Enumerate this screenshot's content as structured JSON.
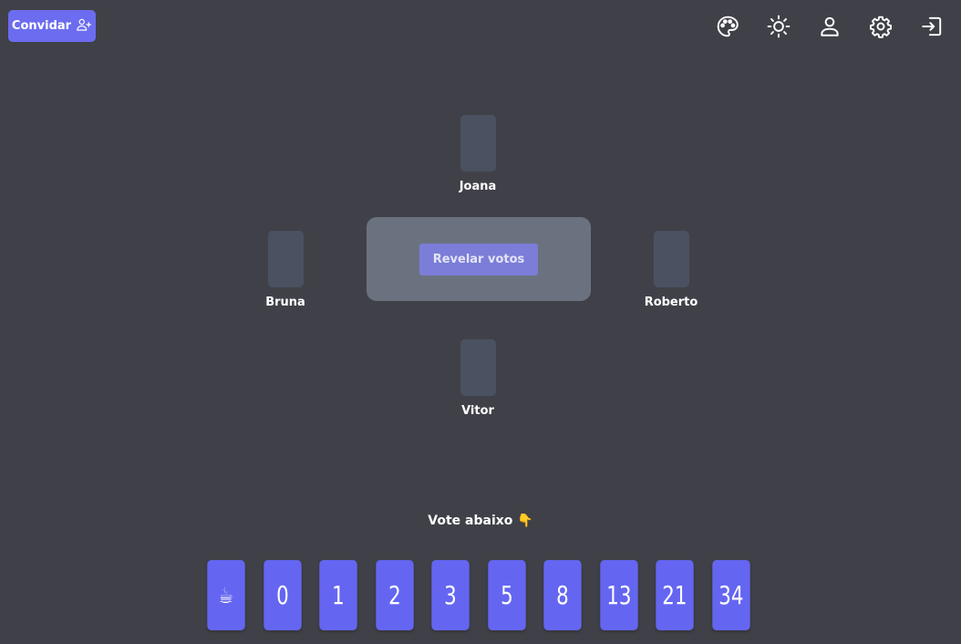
{
  "header": {
    "invite_label": "Convidar",
    "icons": [
      "palette-icon",
      "sun-icon",
      "user-icon",
      "gear-icon",
      "logout-icon"
    ]
  },
  "players": [
    {
      "name": "Joana",
      "position": "top"
    },
    {
      "name": "Bruna",
      "position": "left"
    },
    {
      "name": "Roberto",
      "position": "right"
    },
    {
      "name": "Vitor",
      "position": "bottom"
    }
  ],
  "table": {
    "reveal_label": "Revelar votos"
  },
  "vote": {
    "prompt": "Vote abaixo 👇",
    "cards": [
      "☕",
      "0",
      "1",
      "2",
      "3",
      "5",
      "8",
      "13",
      "21",
      "34"
    ]
  },
  "colors": {
    "background": "#404148",
    "accent": "#6466f1",
    "table": "#6b727f",
    "player_card": "#4a5261"
  }
}
